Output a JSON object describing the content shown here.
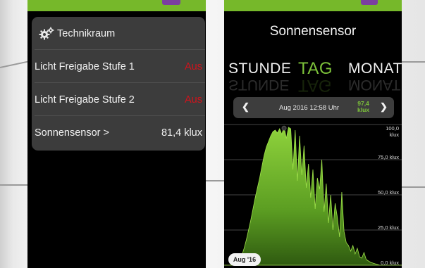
{
  "left_screen": {
    "header": {
      "icon": "gears-icon",
      "title": "Technikraum"
    },
    "rows": [
      {
        "label": "Licht Freigabe Stufe 1",
        "value": "Aus"
      },
      {
        "label": "Licht Freigabe Stufe 2",
        "value": "Aus"
      },
      {
        "label": "Sonnensensor >",
        "value": "81,4 klux"
      }
    ]
  },
  "right_screen": {
    "title": "Sonnensensor",
    "periods": [
      "STUNDE",
      "TAG",
      "MONAT"
    ],
    "active_period": "TAG",
    "date_bar": {
      "prev_icon": "chevron-left-icon",
      "next_icon": "chevron-right-icon",
      "date_text": "Aug 2016 12:58 Uhr",
      "current_value": "97,4",
      "current_unit": "klux"
    },
    "x_badge": "Aug '16"
  },
  "colors": {
    "accent_green": "#76b82a",
    "value_red": "#d0131c",
    "card_bg": "#3c3c3c"
  },
  "chart_data": {
    "type": "area",
    "title": "",
    "xlabel": "",
    "ylabel": "",
    "ylim": [
      0,
      100
    ],
    "y_ticks": [
      {
        "value": 0,
        "label": "0,0 klux"
      },
      {
        "value": 25,
        "label": "25,0 klux"
      },
      {
        "value": 50,
        "label": "50,0 klux"
      },
      {
        "value": 75,
        "label": "75,0 klux"
      },
      {
        "value": 100,
        "label": "100,0 klux"
      }
    ],
    "x": [
      0,
      1,
      2,
      3,
      4,
      5,
      6,
      7,
      8,
      9,
      10,
      11,
      12,
      13,
      14,
      15,
      16,
      17,
      18,
      19,
      20,
      21,
      22,
      23,
      24,
      25,
      26,
      27,
      28,
      29,
      30,
      31,
      32,
      33,
      34,
      35,
      36,
      37,
      38,
      39,
      40,
      41,
      42,
      43,
      44,
      45,
      46,
      47,
      48,
      49,
      50,
      51,
      52,
      53,
      54,
      55,
      56,
      57,
      58,
      59,
      60,
      61,
      62,
      63,
      64,
      65,
      66,
      67,
      68,
      69,
      70,
      71,
      72,
      73,
      74,
      75,
      76,
      77,
      78,
      79,
      80
    ],
    "values": [
      0,
      0,
      0,
      0,
      0.5,
      1,
      2,
      4,
      7,
      12,
      18,
      25,
      32,
      40,
      48,
      55,
      62,
      70,
      78,
      84,
      88,
      92,
      95,
      96,
      94,
      97,
      93,
      99,
      90,
      98,
      97,
      68,
      96,
      60,
      92,
      64,
      85,
      55,
      72,
      48,
      68,
      40,
      62,
      54,
      75,
      38,
      58,
      30,
      50,
      25,
      44,
      34,
      20,
      52,
      24,
      16,
      14,
      10,
      14,
      8,
      12,
      6,
      5,
      9,
      4,
      3,
      2,
      1.5,
      1,
      0.5,
      0,
      0,
      0,
      0,
      0,
      0,
      0,
      0,
      0,
      0,
      0
    ],
    "marker": {
      "x": 27,
      "y": 97.4
    },
    "grid": true
  }
}
